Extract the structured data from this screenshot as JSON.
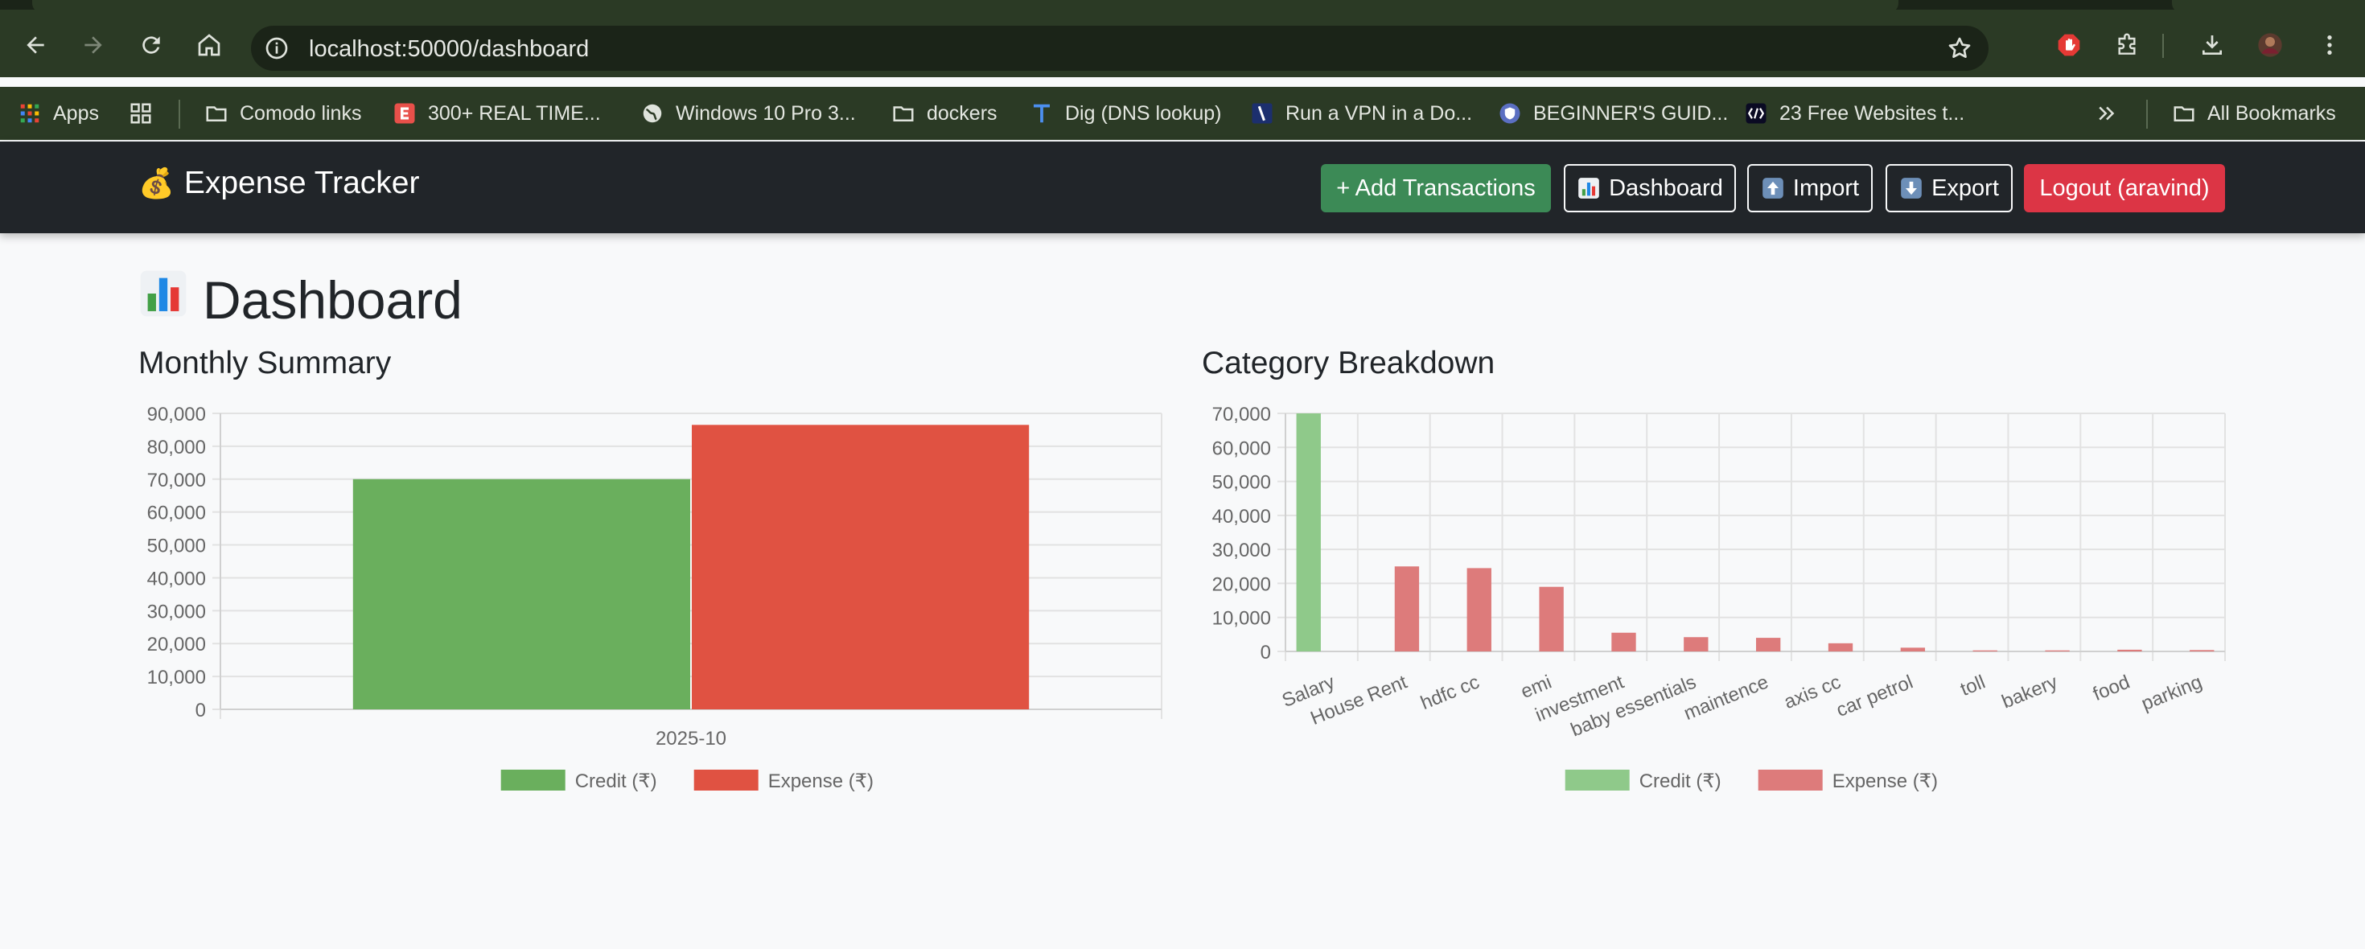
{
  "browser": {
    "url": "localhost:50000/dashboard",
    "bookmarks": [
      {
        "label": "Apps",
        "icon": "apps-grid-icon"
      },
      {
        "label": "",
        "icon": "tab-groups-icon"
      },
      {
        "label": "Comodo links",
        "icon": "folder-icon"
      },
      {
        "label": "300+ REAL TIME...",
        "icon": "e-logo-icon"
      },
      {
        "label": "Windows 10 Pro 3...",
        "icon": "globe-icon"
      },
      {
        "label": "dockers",
        "icon": "folder-icon"
      },
      {
        "label": "Dig (DNS lookup)",
        "icon": "t-logo-icon"
      },
      {
        "label": "Run a VPN in a Do...",
        "icon": "slash-logo-icon"
      },
      {
        "label": "BEGINNER'S GUID...",
        "icon": "shield-logo-icon"
      },
      {
        "label": "23 Free Websites t...",
        "icon": "code-logo-icon"
      }
    ],
    "all_bookmarks": "All Bookmarks"
  },
  "app": {
    "brand": "Expense Tracker",
    "brand_emoji": "💰",
    "nav": {
      "add": "+ Add Transactions",
      "dashboard": "Dashboard",
      "import": "Import",
      "export": "Export",
      "logout": "Logout (aravind)"
    }
  },
  "page": {
    "title": "Dashboard",
    "title_emoji": "📊",
    "monthly_heading": "Monthly Summary",
    "category_heading": "Category Breakdown"
  },
  "colors": {
    "credit_monthly": "#6aaf5d",
    "expense_monthly": "#e05242",
    "credit_category": "#8fc98a",
    "expense_category": "#dd7b7b",
    "navbar": "#212529",
    "success": "#3c8a56",
    "danger": "#dc3545"
  },
  "chart_data": [
    {
      "type": "bar",
      "title": "Monthly Summary",
      "categories": [
        "2025-10"
      ],
      "series": [
        {
          "name": "Credit (₹)",
          "values": [
            70000
          ]
        },
        {
          "name": "Expense (₹)",
          "values": [
            86500
          ]
        }
      ],
      "ylim": [
        0,
        90000
      ],
      "yticks": [
        0,
        10000,
        20000,
        30000,
        40000,
        50000,
        60000,
        70000,
        80000,
        90000
      ],
      "grid": true,
      "legend": "bottom"
    },
    {
      "type": "bar",
      "title": "Category Breakdown",
      "categories": [
        "Salary",
        "House Rent",
        "hdfc cc",
        "emi",
        "investment",
        "baby essentials",
        "maintence",
        "axis cc",
        "car petrol",
        "toll",
        "bakery",
        "food",
        "parking"
      ],
      "series": [
        {
          "name": "Credit (₹)",
          "values": [
            70000,
            0,
            0,
            0,
            0,
            0,
            0,
            0,
            0,
            0,
            0,
            0,
            0
          ]
        },
        {
          "name": "Expense (₹)",
          "values": [
            0,
            25000,
            24500,
            19000,
            5500,
            4200,
            4000,
            2400,
            1100,
            300,
            300,
            500,
            400
          ]
        }
      ],
      "ylim": [
        0,
        70000
      ],
      "yticks": [
        0,
        10000,
        20000,
        30000,
        40000,
        50000,
        60000,
        70000
      ],
      "grid": true,
      "legend": "bottom"
    }
  ]
}
